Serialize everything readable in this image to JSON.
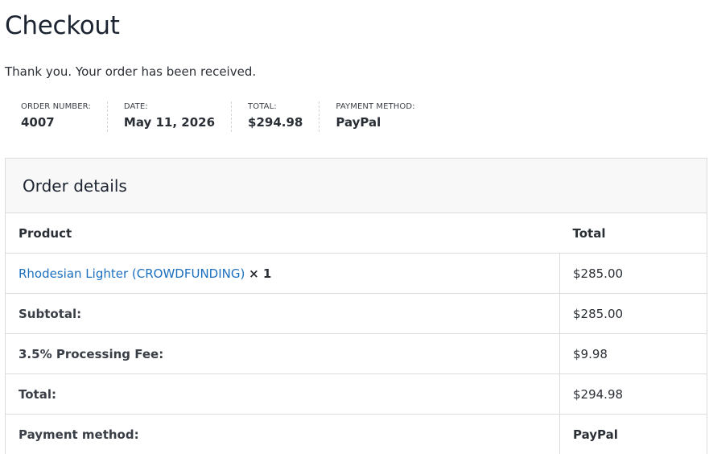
{
  "page": {
    "title": "Checkout",
    "thank_you": "Thank you. Your order has been received."
  },
  "overview": {
    "order_number": {
      "label": "Order number:",
      "value": "4007"
    },
    "date": {
      "label": "Date:",
      "value": "May 11, 2026"
    },
    "total": {
      "label": "Total:",
      "value": "$294.98"
    },
    "payment_method": {
      "label": "Payment method:",
      "value": "PayPal"
    }
  },
  "order_details": {
    "heading": "Order details",
    "headers": {
      "product": "Product",
      "total": "Total"
    },
    "items": [
      {
        "name": "Rhodesian Lighter (CROWDFUNDING)",
        "quantity": "× 1",
        "total": "$285.00"
      }
    ],
    "summary": [
      {
        "label": "Subtotal:",
        "value": "$285.00"
      },
      {
        "label": "3.5% Processing Fee:",
        "value": "$9.98"
      },
      {
        "label": "Total:",
        "value": "$294.98"
      },
      {
        "label": "Payment method:",
        "value": "PayPal"
      }
    ]
  },
  "colors": {
    "link": "#1a6fbf",
    "heading": "#1c2331",
    "border": "#dcdcdc",
    "panel_bg": "#f8f8f8"
  }
}
